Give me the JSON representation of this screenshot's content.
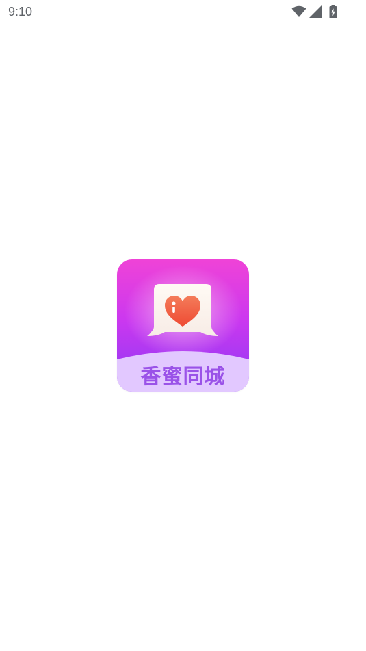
{
  "status_bar": {
    "time": "9:10",
    "icons": [
      "wifi-icon",
      "cellular-signal-icon",
      "battery-charging-icon"
    ],
    "icon_color": "#5f6368"
  },
  "splash": {
    "logo_text": "香蜜同城",
    "logo_icon": "heart-chat-bubble-icon",
    "colors": {
      "gradient_top": "#ef43d7",
      "gradient_bottom": "#8b3af5",
      "band": "#e2c8ff",
      "heart": "#f25a3c",
      "text": "#9a52e8"
    }
  }
}
